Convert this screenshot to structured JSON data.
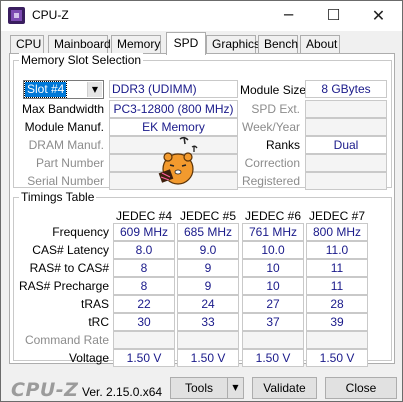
{
  "window": {
    "title": "CPU-Z",
    "minimize": "─",
    "maximize": "☐",
    "close": "✕"
  },
  "tabs": [
    {
      "label": "CPU"
    },
    {
      "label": "Mainboard"
    },
    {
      "label": "Memory"
    },
    {
      "label": "SPD"
    },
    {
      "label": "Graphics"
    },
    {
      "label": "Bench"
    },
    {
      "label": "About"
    }
  ],
  "active_tab": "SPD",
  "slot_selection": {
    "group_title": "Memory Slot Selection",
    "selected_slot": "Slot #4",
    "memory_type": "DDR3 (UDIMM)",
    "labels": {
      "max_bandwidth": "Max Bandwidth",
      "module_manuf": "Module Manuf.",
      "dram_manuf": "DRAM Manuf.",
      "part_number": "Part Number",
      "serial_number": "Serial Number",
      "module_size": "Module Size",
      "spd_ext": "SPD Ext.",
      "week_year": "Week/Year",
      "ranks": "Ranks",
      "correction": "Correction",
      "registered": "Registered"
    },
    "values": {
      "max_bandwidth": "PC3-12800 (800 MHz)",
      "module_manuf": "EK Memory",
      "dram_manuf": "",
      "part_number": "",
      "serial_number": "",
      "module_size": "8 GBytes",
      "spd_ext": "",
      "week_year": "",
      "ranks": "Dual",
      "correction": "",
      "registered": ""
    }
  },
  "timings": {
    "group_title": "Timings Table",
    "columns": [
      "JEDEC #4",
      "JEDEC #5",
      "JEDEC #6",
      "JEDEC #7"
    ],
    "rows": [
      {
        "label": "Frequency",
        "values": [
          "609 MHz",
          "685 MHz",
          "761 MHz",
          "800 MHz"
        ]
      },
      {
        "label": "CAS# Latency",
        "values": [
          "8.0",
          "9.0",
          "10.0",
          "11.0"
        ]
      },
      {
        "label": "RAS# to CAS#",
        "values": [
          "8",
          "9",
          "10",
          "11"
        ]
      },
      {
        "label": "RAS# Precharge",
        "values": [
          "8",
          "9",
          "10",
          "11"
        ]
      },
      {
        "label": "tRAS",
        "values": [
          "22",
          "24",
          "27",
          "28"
        ]
      },
      {
        "label": "tRC",
        "values": [
          "30",
          "33",
          "37",
          "39"
        ]
      },
      {
        "label": "Command Rate",
        "values": [
          "",
          "",
          "",
          ""
        ]
      },
      {
        "label": "Voltage",
        "values": [
          "1.50 V",
          "1.50 V",
          "1.50 V",
          "1.50 V"
        ]
      }
    ]
  },
  "footer": {
    "brand": "CPU-Z",
    "version": "Ver. 2.15.0.x64",
    "tools_label": "Tools",
    "validate_label": "Validate",
    "close_label": "Close"
  },
  "colors": {
    "value_text": "#1a1a8a",
    "selection": "#0078d7"
  }
}
